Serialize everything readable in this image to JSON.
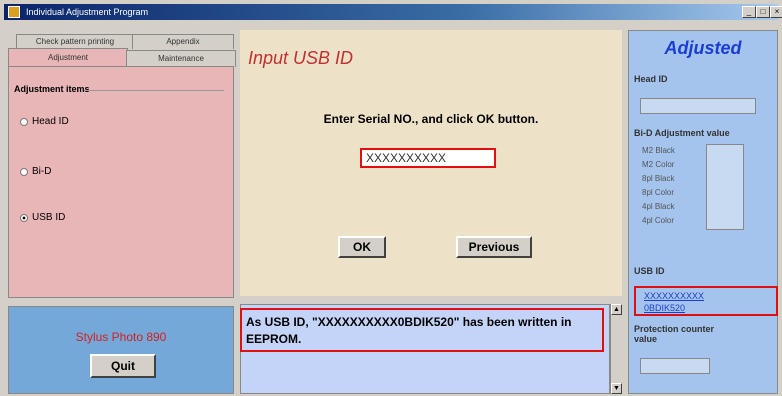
{
  "window": {
    "title": "Individual Adjustment Program"
  },
  "tabs": {
    "row1": [
      "Check pattern printing",
      "Appendix"
    ],
    "row2": [
      "Adjustment",
      "Maintenance"
    ]
  },
  "adjustment_items": {
    "heading": "Adjustment items",
    "options": [
      {
        "label": "Head ID",
        "selected": false
      },
      {
        "label": "Bi-D",
        "selected": false
      },
      {
        "label": "USB ID",
        "selected": true
      }
    ]
  },
  "model": "Stylus Photo 890",
  "quit_label": "Quit",
  "center": {
    "title": "Input USB ID",
    "prompt": "Enter Serial NO., and click OK button.",
    "serial_value": "XXXXXXXXXX",
    "ok_label": "OK",
    "previous_label": "Previous",
    "message": "As USB ID, \"XXXXXXXXXX0BDIK520\" has been written in EEPROM."
  },
  "adjusted": {
    "title": "Adjusted",
    "head_id_label": "Head ID",
    "bid_label": "Bi-D Adjustment value",
    "bid_rows": [
      "M2 Black",
      "M2 Color",
      "8pl Black",
      "8pl Color",
      "4pl Black",
      "4pl Color"
    ],
    "usb_label": "USB ID",
    "usb_value_line1": "XXXXXXXXXX",
    "usb_value_line2": "0BDIK520",
    "protection_label_line1": "Protection counter",
    "protection_label_line2": "value"
  },
  "colors": {
    "highlight": "#e01010",
    "accent_blue": "#1a3ed0",
    "title_red": "#c03030"
  }
}
